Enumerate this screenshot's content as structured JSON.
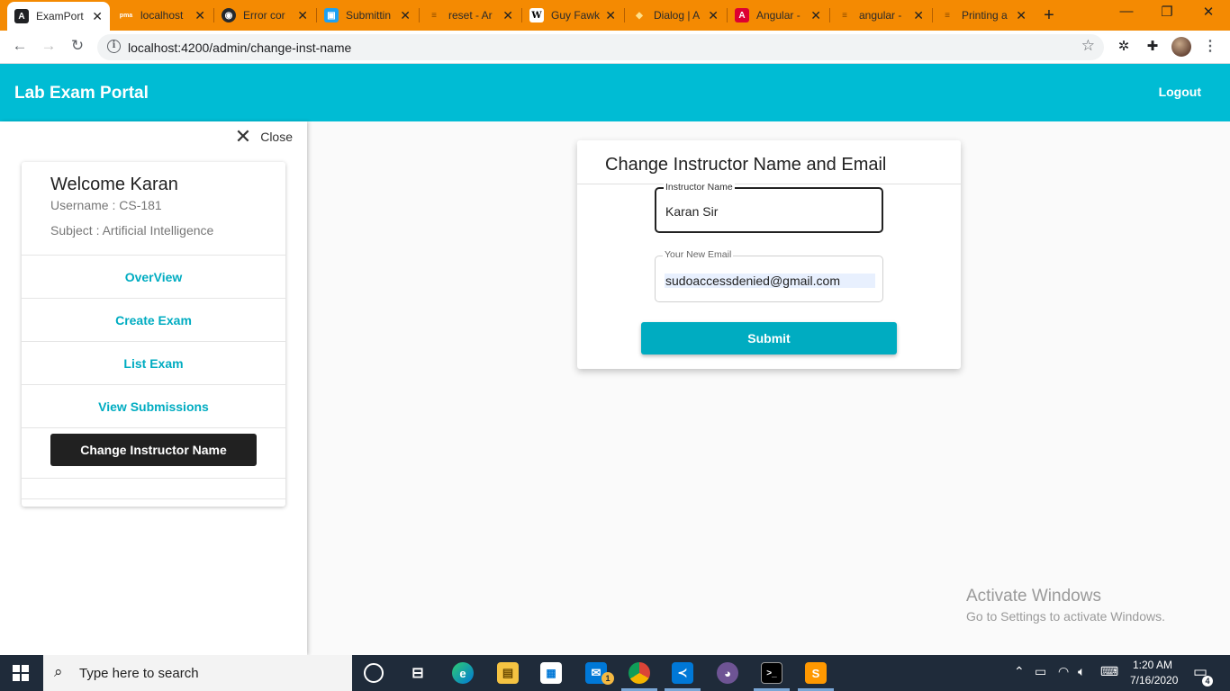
{
  "browser": {
    "tabs": [
      {
        "title": "ExamPort",
        "favicon": "angular-icon",
        "color": "#202124",
        "glyph": "A",
        "active": true
      },
      {
        "title": "localhost",
        "favicon": "phpmyadmin-icon",
        "color": "#f48a02",
        "glyph": "pma"
      },
      {
        "title": "Error cor",
        "favicon": "github-icon",
        "color": "#24292e",
        "glyph": "◉"
      },
      {
        "title": "Submittin",
        "favicon": "chat-icon",
        "color": "#1da1f2",
        "glyph": "▣"
      },
      {
        "title": "reset - Ar",
        "favicon": "stackoverflow-icon",
        "color": "#f48024",
        "glyph": "≡"
      },
      {
        "title": "Guy Fawk",
        "favicon": "wikipedia-icon",
        "color": "#ffffff",
        "glyph": "W"
      },
      {
        "title": "Dialog | A",
        "favicon": "material-icon",
        "color": "#ffb300",
        "glyph": "◆"
      },
      {
        "title": "Angular -",
        "favicon": "angular-icon",
        "color": "#dd0031",
        "glyph": "A"
      },
      {
        "title": "angular -",
        "favicon": "stackoverflow-icon",
        "color": "#f48024",
        "glyph": "≡"
      },
      {
        "title": "Printing a",
        "favicon": "stackoverflow-icon",
        "color": "#f48024",
        "glyph": "≡"
      }
    ],
    "url": "localhost:4200/admin/change-inst-name"
  },
  "app": {
    "title": "Lab Exam Portal",
    "logout_label": "Logout",
    "colors": {
      "primary": "#00bcd4",
      "accent": "#00acc1",
      "active_item": "#212121"
    }
  },
  "sidenav": {
    "close_label": "Close",
    "welcome": "Welcome Karan",
    "username": "Username : CS-181",
    "subject": "Subject : Artificial Intelligence",
    "items": [
      {
        "label": "OverView"
      },
      {
        "label": "Create Exam"
      },
      {
        "label": "List Exam"
      },
      {
        "label": "View Submissions"
      },
      {
        "label": "Change Instructor Name",
        "active": true
      }
    ]
  },
  "form": {
    "title": "Change Instructor Name and Email",
    "name_label": "Instructor Name",
    "name_value": "Karan Sir",
    "email_label": "Your New Email",
    "email_value": "sudoaccessdenied@gmail.com",
    "submit_label": "Submit"
  },
  "watermark": {
    "line1": "Activate Windows",
    "line2": "Go to Settings to activate Windows."
  },
  "taskbar": {
    "search_placeholder": "Type here to search",
    "mail_badge": "1",
    "time": "1:20 AM",
    "date": "7/16/2020",
    "notification_count": "4"
  }
}
